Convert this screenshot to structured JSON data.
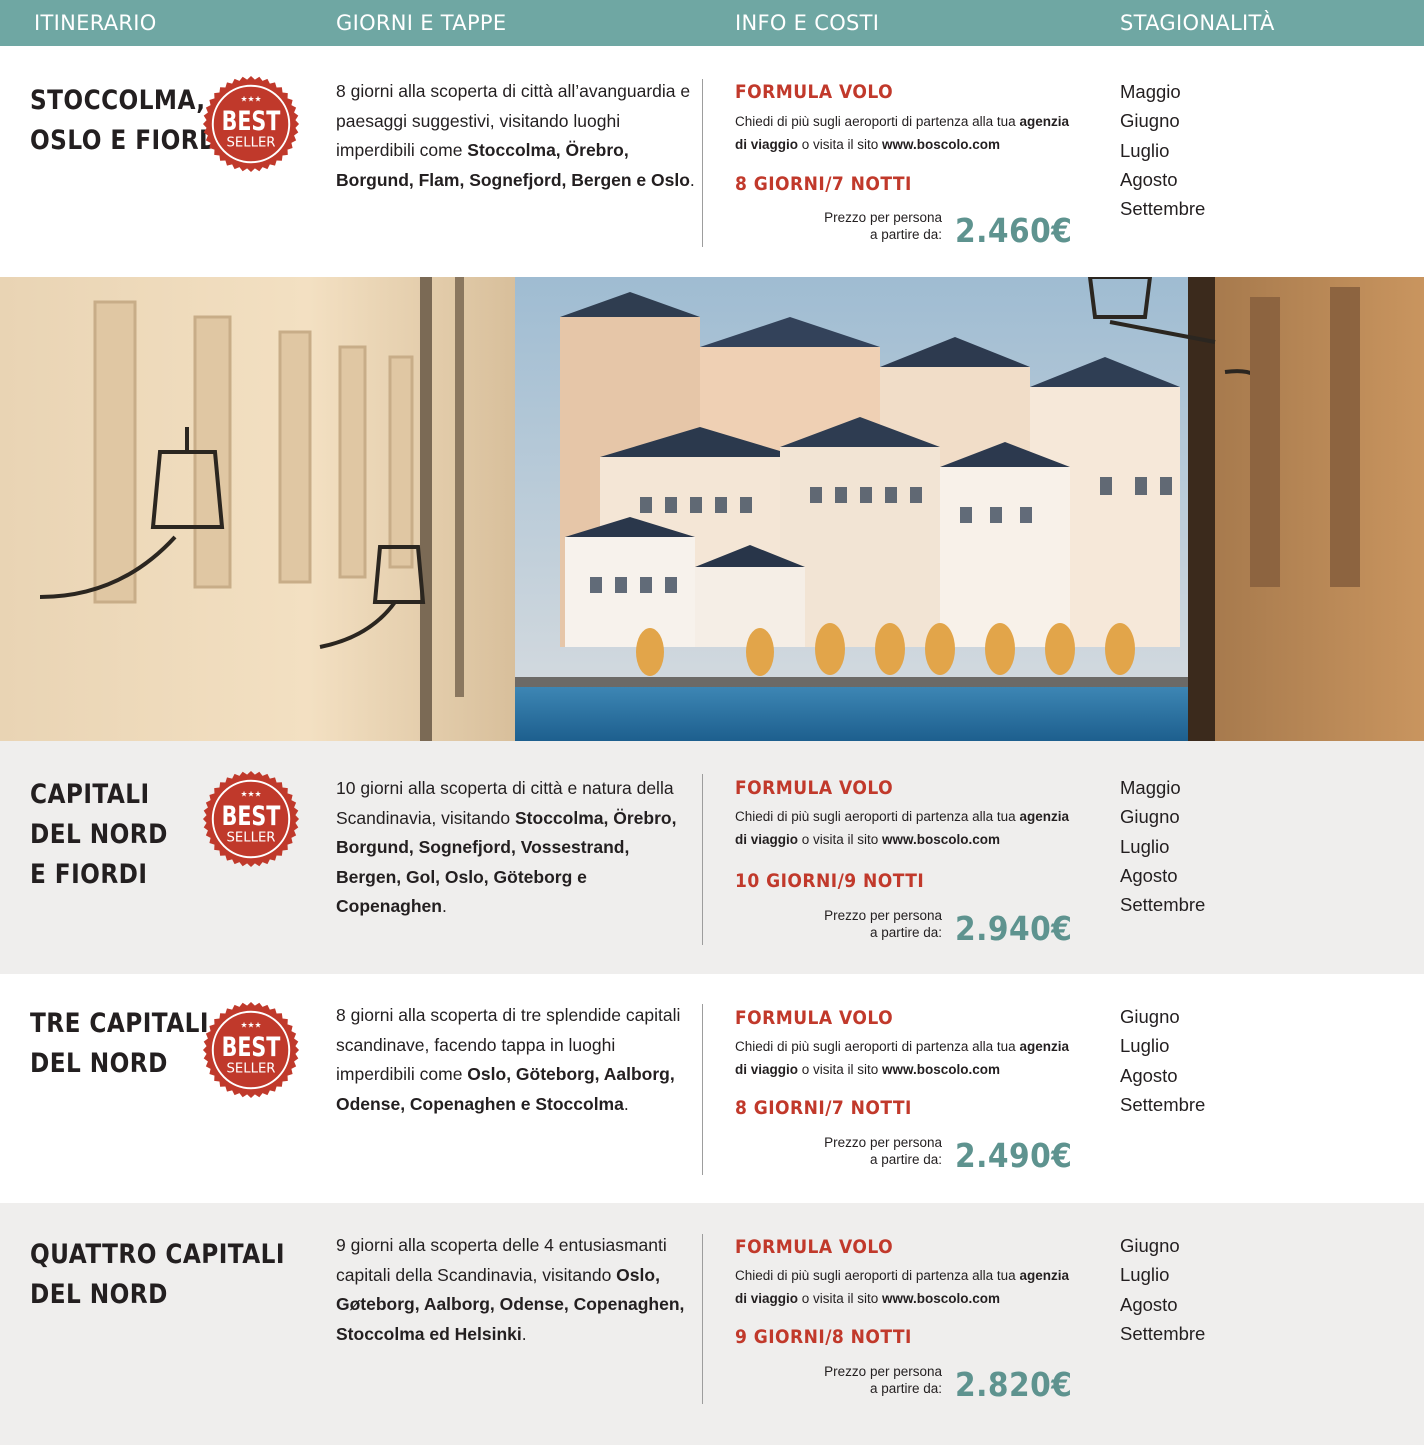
{
  "header": {
    "col1": "ITINERARIO",
    "col2": "GIORNI E TAPPE",
    "col3": "INFO E COSTI",
    "col4": "STAGIONALITÀ"
  },
  "colors": {
    "header_bg": "#6fa7a3",
    "accent_red": "#c1392b",
    "price_teal": "#5e938f",
    "row_gray": "#efeeed"
  },
  "badge": {
    "line1": "BEST",
    "line2": "SELLER",
    "stars": "★★★",
    "icon": "best-seller-seal-icon"
  },
  "photo": {
    "icon": "stockholm-photo"
  },
  "itineraries": [
    {
      "title_lines": [
        "STOCCOLMA,",
        "OSLO E FIORDI"
      ],
      "best_seller": true,
      "desc_segments": [
        [
          "8 giorni alla scoperta di città all’avanguardia e paesaggi suggestivi, visitando luoghi imperdibili come ",
          false
        ],
        [
          "Stoccolma, Örebro, Borgund, Flam, Sognefjord, Bergen e Oslo",
          true
        ],
        [
          ".",
          false
        ]
      ],
      "formula": "FORMULA VOLO",
      "note_a": "Chiedi di più sugli aeroporti di partenza alla tua ",
      "note_b": "agenzia di viaggio",
      "note_c": " o visita il sito ",
      "note_d": "www.boscolo.com",
      "duration": "8 GIORNI/7 NOTTI",
      "price_label_1": "Prezzo per persona",
      "price_label_2": "a partire da:",
      "price": "2.460€",
      "months": [
        "Maggio",
        "Giugno",
        "Luglio",
        "Agosto",
        "Settembre"
      ]
    },
    {
      "title_lines": [
        "CAPITALI",
        "DEL NORD",
        "E FIORDI"
      ],
      "best_seller": true,
      "desc_segments": [
        [
          "10 giorni alla scoperta di città e natura della Scandinavia, visitando ",
          false
        ],
        [
          "Stoccolma, Örebro, Borgund, Sognefjord, Vossestrand, Bergen, Gol, Oslo, Göteborg e Copenaghen",
          true
        ],
        [
          ".",
          false
        ]
      ],
      "formula": "FORMULA VOLO",
      "note_a": "Chiedi di più sugli aeroporti di partenza alla tua ",
      "note_b": "agenzia di viaggio",
      "note_c": " o visita il sito ",
      "note_d": "www.boscolo.com",
      "duration": "10 GIORNI/9 NOTTI",
      "price_label_1": "Prezzo per persona",
      "price_label_2": "a partire da:",
      "price": "2.940€",
      "months": [
        "Maggio",
        "Giugno",
        "Luglio",
        "Agosto",
        "Settembre"
      ]
    },
    {
      "title_lines": [
        "TRE CAPITALI",
        "DEL NORD"
      ],
      "best_seller": true,
      "desc_segments": [
        [
          "8 giorni alla scoperta di tre splendide capitali scandinave, facendo tappa in luoghi imperdibili come ",
          false
        ],
        [
          "Oslo, Göteborg, Aalborg, Odense, Copenaghen e Stoccolma",
          true
        ],
        [
          ".",
          false
        ]
      ],
      "formula": "FORMULA VOLO",
      "note_a": "Chiedi di più sugli aeroporti di partenza alla tua ",
      "note_b": "agenzia di viaggio",
      "note_c": " o visita il sito ",
      "note_d": "www.boscolo.com",
      "duration": "8 GIORNI/7 NOTTI",
      "price_label_1": "Prezzo per persona",
      "price_label_2": "a partire da:",
      "price": "2.490€",
      "months": [
        "Giugno",
        "Luglio",
        "Agosto",
        "Settembre"
      ]
    },
    {
      "title_lines": [
        "QUATTRO CAPITALI",
        "DEL NORD"
      ],
      "best_seller": false,
      "desc_segments": [
        [
          "9 giorni alla scoperta delle 4 entusiasmanti capitali della Scandinavia, visitando ",
          false
        ],
        [
          "Oslo, Gøteborg, Aalborg, Odense, Copenaghen, Stoccolma ed Helsinki",
          true
        ],
        [
          ".",
          false
        ]
      ],
      "formula": "FORMULA VOLO",
      "note_a": "Chiedi di più sugli aeroporti di partenza alla tua ",
      "note_b": "agenzia di viaggio",
      "note_c": " o visita il sito ",
      "note_d": "www.boscolo.com",
      "duration": "9 GIORNI/8 NOTTI",
      "price_label_1": "Prezzo per persona",
      "price_label_2": "a partire da:",
      "price": "2.820€",
      "months": [
        "Giugno",
        "Luglio",
        "Agosto",
        "Settembre"
      ]
    }
  ]
}
